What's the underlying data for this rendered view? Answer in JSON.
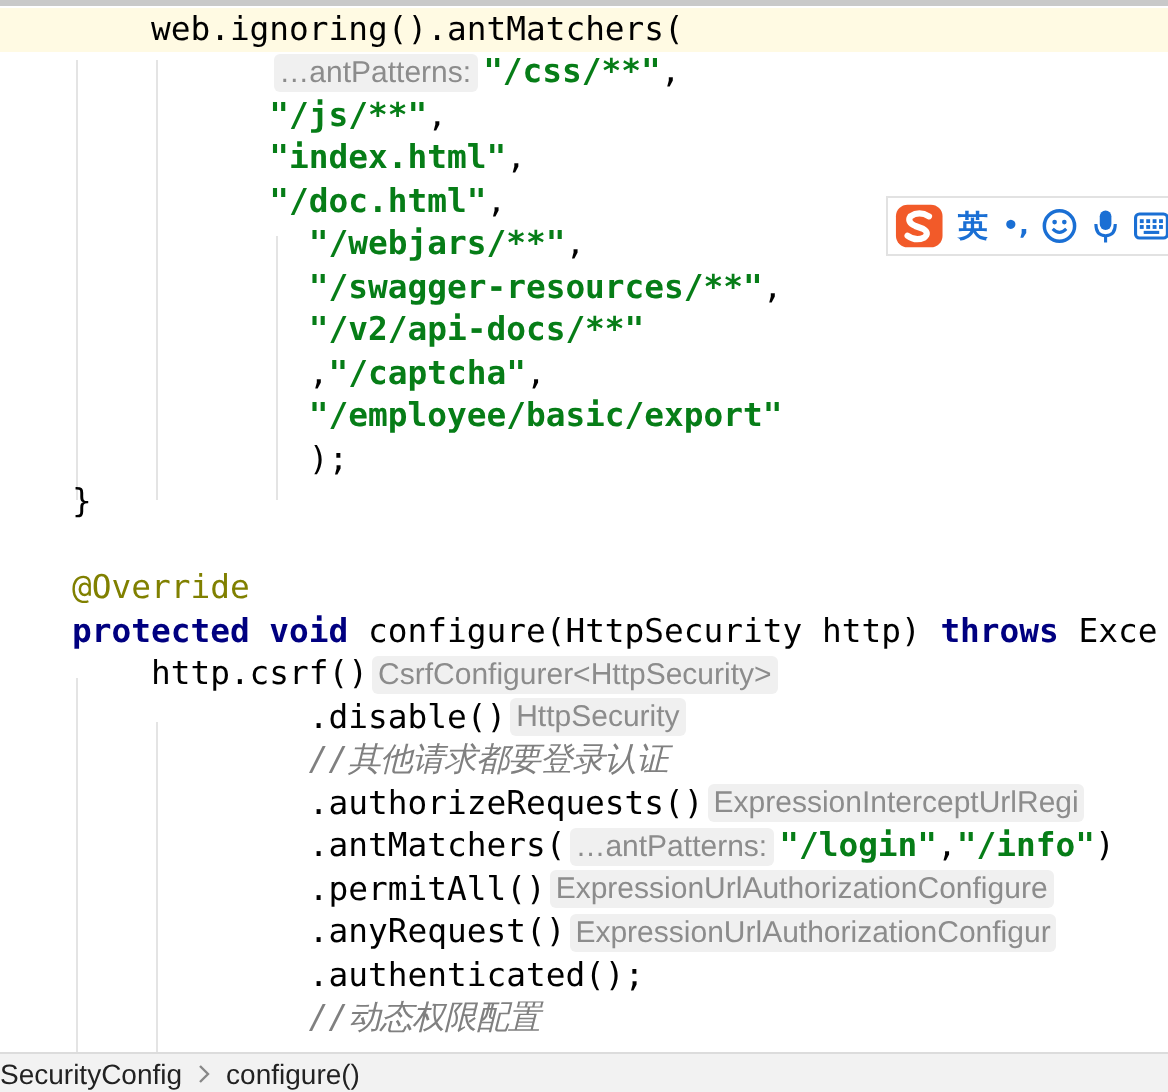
{
  "editor": {
    "lines": [
      {
        "kind": "statement",
        "current": true,
        "segments": [
          {
            "kind": "plain",
            "text": "web.ignoring().antMatchers("
          }
        ]
      },
      {
        "kind": "argument",
        "current": false,
        "segments": [
          {
            "kind": "hint",
            "text": "…antPatterns:"
          },
          {
            "kind": "string",
            "text": "\"/css/**\""
          },
          {
            "kind": "plain",
            "text": ","
          }
        ]
      },
      {
        "kind": "argument",
        "current": false,
        "segments": [
          {
            "kind": "string",
            "text": "\"/js/**\""
          },
          {
            "kind": "plain",
            "text": ","
          }
        ]
      },
      {
        "kind": "argument",
        "current": false,
        "segments": [
          {
            "kind": "string",
            "text": "\"index.html\""
          },
          {
            "kind": "plain",
            "text": ","
          }
        ]
      },
      {
        "kind": "argument",
        "current": false,
        "segments": [
          {
            "kind": "string",
            "text": "\"/doc.html\""
          },
          {
            "kind": "plain",
            "text": ","
          }
        ]
      },
      {
        "kind": "wrapped",
        "current": false,
        "segments": [
          {
            "kind": "string",
            "text": "\"/webjars/**\""
          },
          {
            "kind": "plain",
            "text": ","
          }
        ]
      },
      {
        "kind": "wrapped",
        "current": false,
        "segments": [
          {
            "kind": "string",
            "text": "\"/swagger-resources/**\""
          },
          {
            "kind": "plain",
            "text": ","
          }
        ]
      },
      {
        "kind": "wrapped",
        "current": false,
        "segments": [
          {
            "kind": "string",
            "text": "\"/v2/api-docs/**\""
          }
        ]
      },
      {
        "kind": "wrapped",
        "current": false,
        "segments": [
          {
            "kind": "plain",
            "text": ","
          },
          {
            "kind": "string",
            "text": "\"/captcha\""
          },
          {
            "kind": "plain",
            "text": ","
          }
        ]
      },
      {
        "kind": "wrapped",
        "current": false,
        "segments": [
          {
            "kind": "string",
            "text": "\"/employee/basic/export\""
          }
        ]
      },
      {
        "kind": "wrapped",
        "current": false,
        "segments": [
          {
            "kind": "plain",
            "text": ");"
          }
        ]
      },
      {
        "kind": "member",
        "current": false,
        "segments": [
          {
            "kind": "plain",
            "text": "}"
          }
        ]
      },
      {
        "kind": "member",
        "current": false
      },
      {
        "kind": "member",
        "current": false,
        "segments": [
          {
            "kind": "annotation",
            "text": "@Override"
          }
        ]
      },
      {
        "kind": "member",
        "current": false,
        "segments": [
          {
            "kind": "keyword",
            "text": "protected void"
          },
          {
            "kind": "plain",
            "text": "configure(HttpSecurity http)"
          },
          {
            "kind": "keyword",
            "text": "throws"
          },
          {
            "kind": "plain",
            "text": "Exce"
          }
        ]
      },
      {
        "kind": "statement",
        "current": false,
        "segments": [
          {
            "kind": "plain",
            "text": "http.csrf()"
          },
          {
            "kind": "hint",
            "text": "CsrfConfigurer<HttpSecurity>"
          }
        ]
      },
      {
        "kind": "wrapped",
        "current": false,
        "segments": [
          {
            "kind": "plain",
            "text": ".disable()"
          },
          {
            "kind": "hint",
            "text": "HttpSecurity"
          }
        ]
      },
      {
        "kind": "wrapped",
        "current": false,
        "segments": [
          {
            "kind": "comment",
            "text": "//其他请求都要登录认证"
          }
        ]
      },
      {
        "kind": "wrapped",
        "current": false,
        "segments": [
          {
            "kind": "plain",
            "text": ".authorizeRequests()"
          },
          {
            "kind": "hint",
            "text": "ExpressionInterceptUrlRegi"
          }
        ]
      },
      {
        "kind": "wrapped",
        "current": false,
        "segments": [
          {
            "kind": "plain",
            "text": ".antMatchers("
          },
          {
            "kind": "hint",
            "text": "…antPatterns:"
          },
          {
            "kind": "string",
            "text": "\"/login\""
          },
          {
            "kind": "plain",
            "text": ","
          },
          {
            "kind": "string",
            "text": "\"/info\""
          },
          {
            "kind": "plain",
            "text": ")"
          }
        ]
      },
      {
        "kind": "wrapped",
        "current": false,
        "segments": [
          {
            "kind": "plain",
            "text": ".permitAll()"
          },
          {
            "kind": "hint",
            "text": "ExpressionUrlAuthorizationConfigure"
          }
        ]
      },
      {
        "kind": "wrapped",
        "current": false,
        "segments": [
          {
            "kind": "plain",
            "text": ".anyRequest()"
          },
          {
            "kind": "hint",
            "text": "ExpressionUrlAuthorizationConfigur"
          }
        ]
      },
      {
        "kind": "wrapped",
        "current": false,
        "segments": [
          {
            "kind": "plain",
            "text": ".authenticated();"
          }
        ]
      },
      {
        "kind": "wrapped",
        "current": false,
        "segments": [
          {
            "kind": "comment",
            "text": "//动态权限配置"
          }
        ]
      }
    ]
  },
  "ime_toolbar": {
    "language": "英",
    "punctuation": "•,"
  },
  "breadcrumbs": [
    "SecurityConfig",
    "configure()"
  ]
}
